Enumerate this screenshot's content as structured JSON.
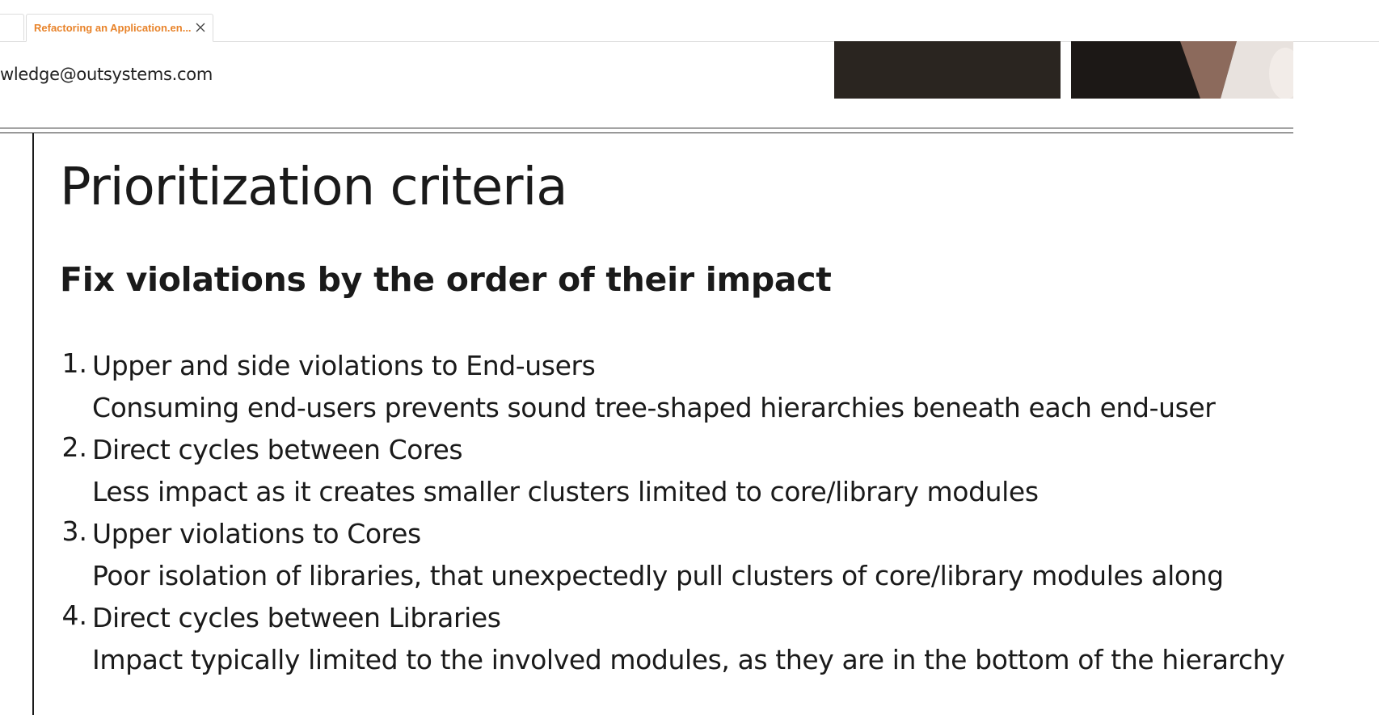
{
  "browser": {
    "active_tab_title": "Refactoring an Application.en..."
  },
  "header": {
    "email_fragment": "wledge@outsystems.com"
  },
  "slide": {
    "title": "Prioritization criteria",
    "subtitle": "Fix violations by the order of their impact",
    "items": [
      {
        "number": "1.",
        "heading": "Upper and side violations to End-users",
        "description": "Consuming end-users prevents sound tree-shaped hierarchies beneath each end-user"
      },
      {
        "number": "2.",
        "heading": "Direct cycles between Cores",
        "description": "Less impact as it creates smaller clusters limited to core/library modules"
      },
      {
        "number": "3.",
        "heading": "Upper violations to Cores",
        "description": "Poor isolation of libraries, that unexpectedly pull clusters of core/library modules along"
      },
      {
        "number": "4.",
        "heading": "Direct cycles between Libraries",
        "description": "Impact typically limited to the involved modules, as they are in the bottom of the hierarchy"
      }
    ]
  },
  "colors": {
    "tab_accent": "#e8832a",
    "text": "#1a1a1a"
  }
}
